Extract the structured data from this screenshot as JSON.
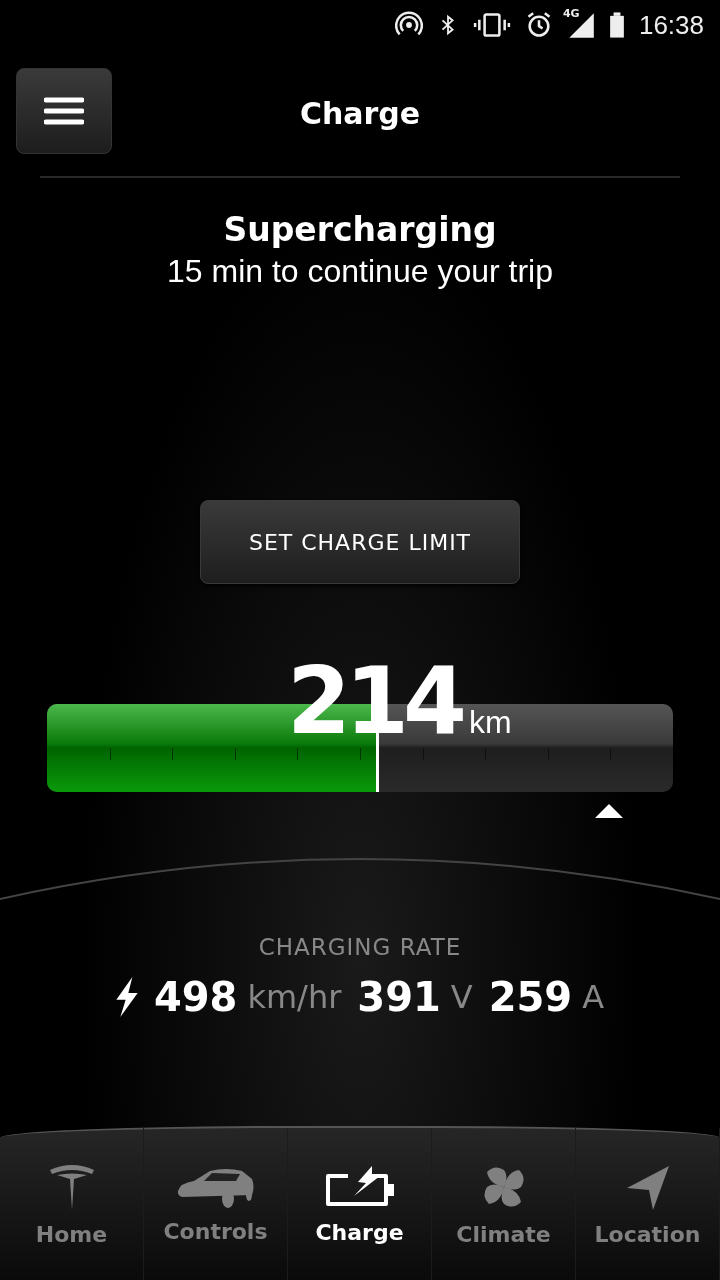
{
  "status_bar": {
    "network": "4G",
    "time": "16:38"
  },
  "header": {
    "title": "Charge"
  },
  "status": {
    "title": "Supercharging",
    "subtitle": "15 min to continue your trip"
  },
  "set_limit_button": "SET CHARGE LIMIT",
  "range": {
    "value": "214",
    "unit": "km",
    "level": 0.53
  },
  "charging_rate": {
    "label": "CHARGING RATE",
    "readings": [
      {
        "value": "498",
        "unit": "km/hr"
      },
      {
        "value": "391",
        "unit": "V"
      },
      {
        "value": "259",
        "unit": "A"
      }
    ]
  },
  "tabs": [
    {
      "label": "Home",
      "kind": "home",
      "selected": false
    },
    {
      "label": "Controls",
      "kind": "controls",
      "selected": false
    },
    {
      "label": "Charge",
      "kind": "charge",
      "selected": true
    },
    {
      "label": "Climate",
      "kind": "climate",
      "selected": false
    },
    {
      "label": "Location",
      "kind": "location",
      "selected": false
    }
  ]
}
